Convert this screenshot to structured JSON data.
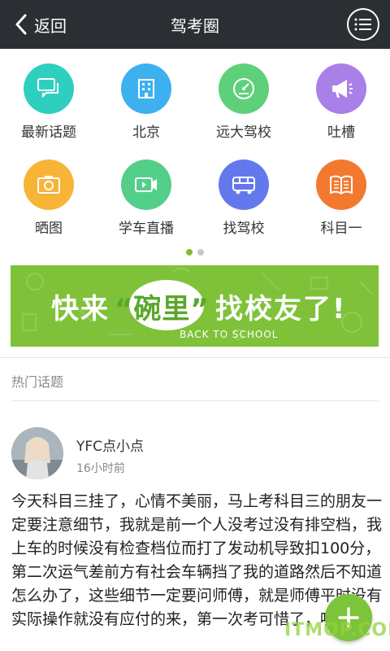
{
  "header": {
    "back_label": "返回",
    "title": "驾考圈",
    "back_icon": "chevron-left-icon",
    "menu_icon": "list-menu-icon"
  },
  "grid": [
    {
      "label": "最新话题",
      "icon": "chat-bubbles-icon",
      "color": "#2fcfc0"
    },
    {
      "label": "北京",
      "icon": "building-icon",
      "color": "#3db0f0"
    },
    {
      "label": "远大驾校",
      "icon": "speedometer-icon",
      "color": "#5fd07a"
    },
    {
      "label": "吐槽",
      "icon": "megaphone-icon",
      "color": "#a97fe8"
    },
    {
      "label": "晒图",
      "icon": "camera-icon",
      "color": "#f7b436"
    },
    {
      "label": "学车直播",
      "icon": "video-camera-icon",
      "color": "#53cf8a"
    },
    {
      "label": "找驾校",
      "icon": "bus-icon",
      "color": "#6478ee"
    },
    {
      "label": "科目一",
      "icon": "book-icon",
      "color": "#f3792f"
    }
  ],
  "pager": {
    "total": 2,
    "active": 0
  },
  "banner": {
    "text_left": "快来",
    "text_bubble": "“碗里”",
    "text_right": "找校友了!",
    "subtitle": "BACK TO SCHOOL",
    "bg_color": "#7fc23a"
  },
  "hot_section": {
    "title": "热门话题"
  },
  "post": {
    "username": "YFC点小点",
    "time": "16小时前",
    "content": "今天科目三挂了，心情不美丽，马上考科目三的朋友一定要注意细节，我就是前一个人没考过没有排空档，我上车的时候没有检查档位而打了发动机导致扣100分，第二次运气差前方有社会车辆挡了我的道路然后不知道怎么办了，这些细节一定要问师傅，就是师傅平时没有实际操作就没有应付的来，第一次考可惜了，哎"
  },
  "fab": {
    "icon": "plus-icon",
    "color": "#7cc43a"
  },
  "watermark": "ITMOP.COM"
}
